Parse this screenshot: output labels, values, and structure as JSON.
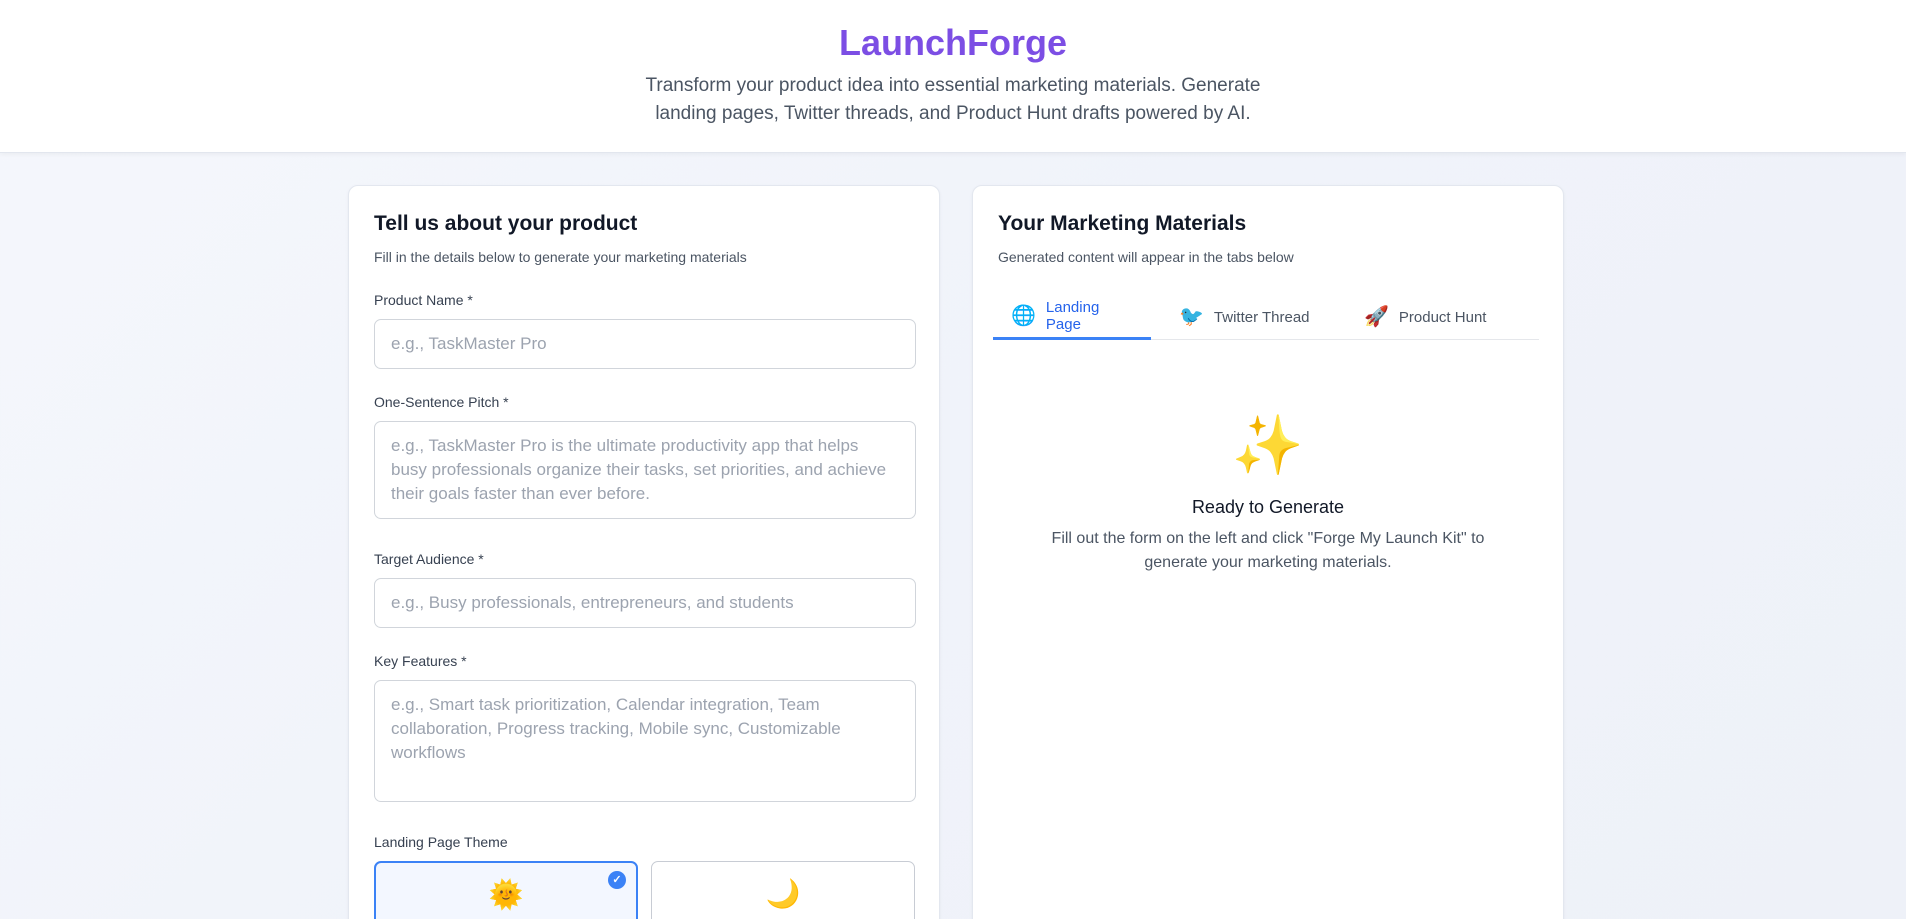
{
  "header": {
    "brand": "LaunchForge",
    "tagline": "Transform your product idea into essential marketing materials. Generate landing pages, Twitter threads, and Product Hunt drafts powered by AI."
  },
  "form": {
    "title": "Tell us about your product",
    "subtitle": "Fill in the details below to generate your marketing materials",
    "product_name": {
      "label": "Product Name *",
      "value": "",
      "placeholder": "e.g., TaskMaster Pro"
    },
    "pitch": {
      "label": "One-Sentence Pitch *",
      "value": "",
      "placeholder": "e.g., TaskMaster Pro is the ultimate productivity app that helps busy professionals organize their tasks, set priorities, and achieve their goals faster than ever before."
    },
    "audience": {
      "label": "Target Audience *",
      "value": "",
      "placeholder": "e.g., Busy professionals, entrepreneurs, and students"
    },
    "features": {
      "label": "Key Features *",
      "value": "",
      "placeholder": "e.g., Smart task prioritization, Calendar integration, Team collaboration, Progress tracking, Mobile sync, Customizable workflows"
    },
    "theme": {
      "label": "Landing Page Theme",
      "options": [
        {
          "icon": "sun-icon",
          "emoji": "🌞",
          "selected": true
        },
        {
          "icon": "moon-icon",
          "emoji": "🌙",
          "selected": false
        }
      ]
    }
  },
  "output": {
    "title": "Your Marketing Materials",
    "subtitle": "Generated content will appear in the tabs below",
    "tabs": [
      {
        "label": "Landing Page",
        "icon": "globe-icon",
        "emoji": "🌐",
        "active": true
      },
      {
        "label": "Twitter Thread",
        "icon": "bird-icon",
        "emoji": "🐦",
        "active": false
      },
      {
        "label": "Product Hunt",
        "icon": "rocket-icon",
        "emoji": "🚀",
        "active": false
      }
    ],
    "empty": {
      "icon": "sparkles-icon",
      "emoji": "✨",
      "title": "Ready to Generate",
      "description": "Fill out the form on the left and click \"Forge My Launch Kit\" to generate your marketing materials."
    }
  },
  "colors": {
    "brand": "#7c4ee4",
    "accent": "#3b82f6"
  }
}
